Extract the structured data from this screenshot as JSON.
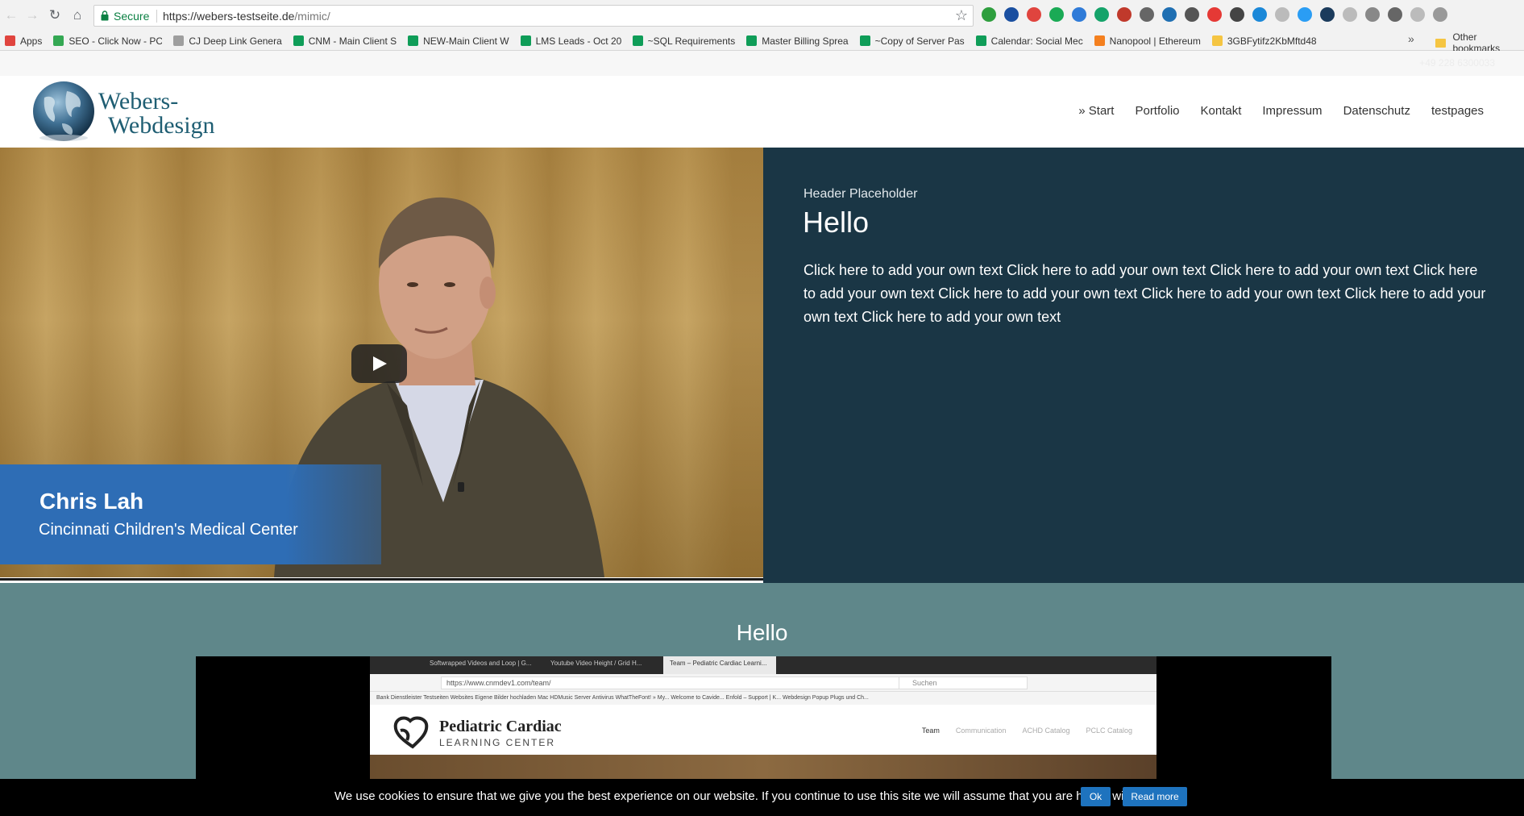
{
  "browser": {
    "secure_label": "Secure",
    "url_host": "https://webers-testseite.de",
    "url_path": "/mimic/",
    "bookmarks": [
      {
        "label": "Apps",
        "color": "#e0443e"
      },
      {
        "label": "SEO - Click Now - PC",
        "color": "#34a853"
      },
      {
        "label": "CJ Deep Link Genera",
        "color": "#9e9e9e"
      },
      {
        "label": "CNM - Main Client S",
        "color": "#0f9d58"
      },
      {
        "label": "NEW-Main Client W",
        "color": "#0f9d58"
      },
      {
        "label": "LMS Leads - Oct 201",
        "color": "#0f9d58"
      },
      {
        "label": "~SQL Requirements",
        "color": "#0f9d58"
      },
      {
        "label": "Master Billing Sprea",
        "color": "#0f9d58"
      },
      {
        "label": "~Copy of Server Pas",
        "color": "#0f9d58"
      },
      {
        "label": "Calendar: Social Mec",
        "color": "#0f9d58"
      },
      {
        "label": "Nanopool | Ethereum",
        "color": "#f4801f"
      },
      {
        "label": "3GBFytifz2KbMftd48",
        "color": "#f5c542"
      }
    ],
    "bookmarks_overflow": "»",
    "other_bookmarks": "Other bookmarks",
    "extension_colors": [
      "#2e9e3e",
      "#1a4fa0",
      "#e0443e",
      "#1aaa55",
      "#2f7bd8",
      "#15a36a",
      "#c0392b",
      "#666666",
      "#1f6fb2",
      "#555555",
      "#e53935",
      "#444444",
      "#1b88d8",
      "#bbbbbb",
      "#2a9df4",
      "#1b3b5c",
      "#bbbbbb",
      "#888888",
      "#666666",
      "#bbbbbb",
      "#999999"
    ]
  },
  "site": {
    "topbar_phone": "+49 228 6300033",
    "logo_line1": "Webers-",
    "logo_line2": "Webdesign",
    "nav": [
      "» Start",
      "Portfolio",
      "Kontakt",
      "Impressum",
      "Datenschutz",
      "testpages"
    ]
  },
  "hero": {
    "video": {
      "speaker_name": "Chris Lah",
      "speaker_org": "Cincinnati Children's Medical Center"
    },
    "header_placeholder": "Header Placeholder",
    "heading": "Hello",
    "text": "Click here to add your own text Click here to add your own text Click here to add your own text Click here to add your own text Click here to add your own text Click here to add your own text Click here to add your own text Click here to add your own text"
  },
  "section2": {
    "heading": "Hello",
    "embedded_screenshot": {
      "tabs": [
        "Softwrapped Videos and Loop | G...",
        "Youtube Video Height / Grid H...",
        "Team – Pediatric Cardiac Learni..."
      ],
      "url": "https://www.cnmdev1.com/team/",
      "search_placeholder": "Suchen",
      "bookmarks": "Bank   Dienstleister   Testseiten   Websites Eigene   Bilder hochladen   Mac   HDMusic   Server   Antivirus   WhatTheFont! » My...   Welcome to Cavide...   Enfold – Support | K...   Webdesign   Popup Plugs und Ch...",
      "logo_line1": "Pediatric Cardiac",
      "logo_line2": "LEARNING CENTER",
      "nav": [
        "Team",
        "Communication",
        "ACHD Catalog",
        "PCLC Catalog"
      ]
    }
  },
  "cookie": {
    "text": "We use cookies to ensure that we give you the best experience on our website. If you continue to use this site we will assume that you are happy with it.",
    "ok_label": "Ok",
    "more_label": "Read more"
  },
  "colors": {
    "hero_right_bg": "#1a3645",
    "section2_bg": "#5f878a",
    "logo_text": "#1f5e73",
    "cookie_button": "#1e73be"
  }
}
